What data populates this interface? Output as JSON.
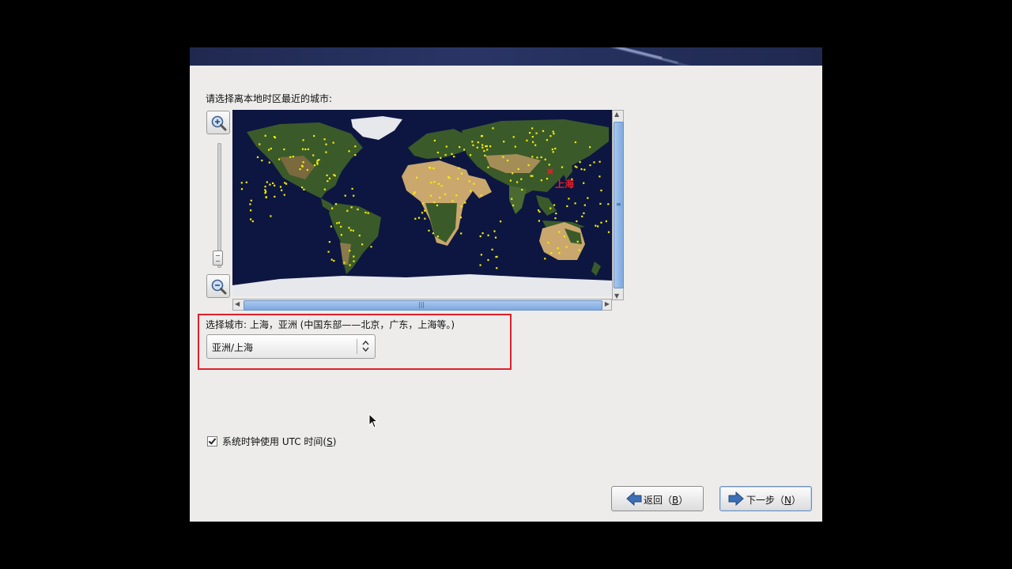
{
  "prompt": "请选择离本地时区最近的城市:",
  "map": {
    "selected_city_label": "上海",
    "colors": {
      "ocean": "#0d1640",
      "land": "#3b5a2a",
      "desert": "#c9a76d",
      "ice": "#e6e8ec",
      "city": "#f5f000",
      "selected": "#e0202a"
    }
  },
  "city_section": {
    "label": "选择城市: 上海，亚洲 (中国东部——北京，广东，上海等。)",
    "combo_value": "亚洲/上海"
  },
  "utc": {
    "label": "系统时钟使用 UTC 时间(",
    "mnemonic": "S",
    "suffix": ")",
    "checked": true
  },
  "buttons": {
    "back": {
      "label": "返回（",
      "mnemonic": "B",
      "suffix": "）"
    },
    "next": {
      "label": "下一步（",
      "mnemonic": "N",
      "suffix": "）"
    }
  },
  "icons": {
    "zoom_in": "zoom-in-icon",
    "zoom_out": "zoom-out-icon",
    "back": "left-arrow-icon",
    "next": "right-arrow-icon"
  }
}
